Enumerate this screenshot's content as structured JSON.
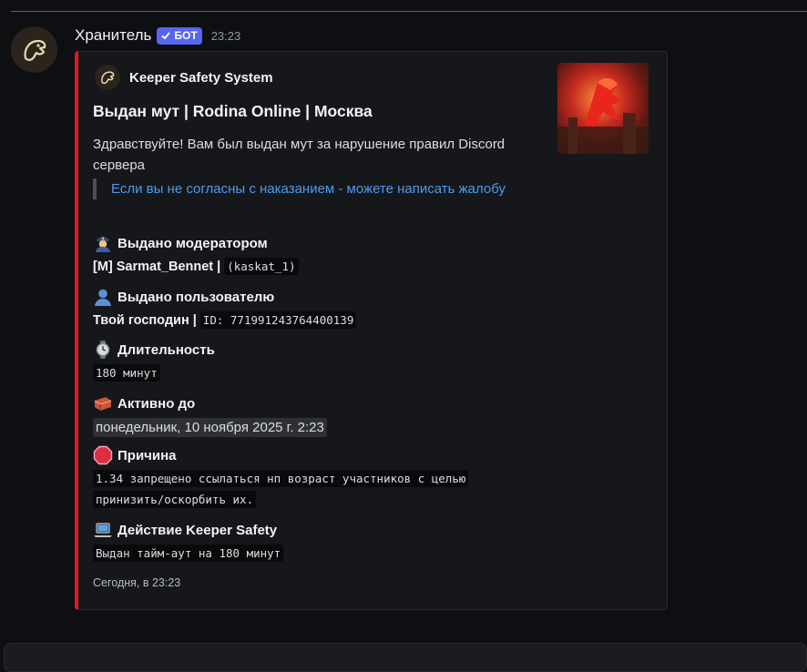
{
  "message": {
    "author": "Хранитель",
    "bot_badge": "БОТ",
    "timestamp": "23:23"
  },
  "embed": {
    "accent_color": "#e01b1b",
    "author_name": "Keeper Safety System",
    "title": "Выдан мут | Rodina Online | Москва",
    "description": "Здравствуйте! Вам был выдан мут за нарушение правил Discord сервера",
    "quote": "Если вы не согласны с наказанием - можете написать жалобу",
    "fields": {
      "moderator": {
        "icon": "police-officer-emoji",
        "name": "Выдано модератором",
        "value_bold": "[M] Sarmat_Bennet |",
        "value_code": "(kaskat_1)"
      },
      "user": {
        "icon": "bust-silhouette-emoji",
        "name": "Выдано пользователю",
        "value_bold": "Твой господин |",
        "value_code": "ID: 771991243764400139"
      },
      "duration": {
        "icon": "watch-emoji",
        "name": "Длительность",
        "value_code": "180 минут"
      },
      "active_until": {
        "icon": "brick-emoji",
        "name": "Активно до",
        "value": "понедельник, 10 ноября 2025 г. 2:23"
      },
      "reason": {
        "icon": "stop-sign-emoji",
        "name": "Причина",
        "line1": "1.34 запрещено ссылаться нп возраст участников с целью",
        "line2": "принизить/оскорбить их."
      },
      "action": {
        "icon": "laptop-emoji",
        "name": "Действие Keeper Safety",
        "value_code": "Выдан тайм-аут на 180 минут"
      }
    },
    "footer": "Сегодня, в 23:23"
  }
}
